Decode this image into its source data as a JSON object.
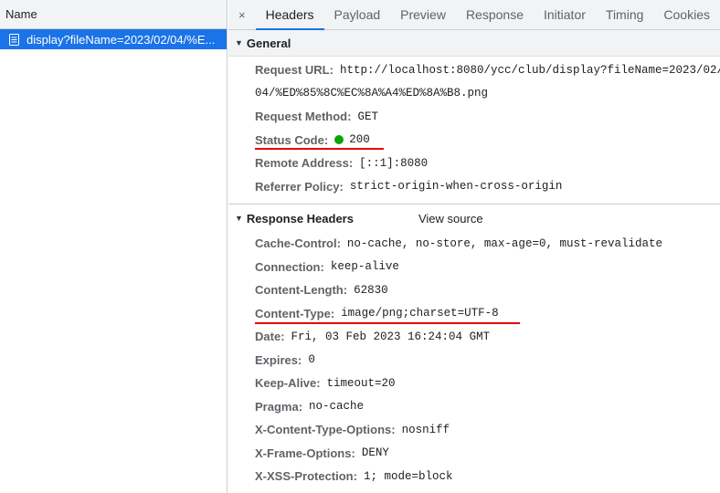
{
  "left": {
    "header": "Name",
    "request": "display?fileName=2023/02/04/%E..."
  },
  "tabs": {
    "close": "×",
    "items": [
      "Headers",
      "Payload",
      "Preview",
      "Response",
      "Initiator",
      "Timing",
      "Cookies"
    ]
  },
  "general": {
    "title": "General",
    "request_url_key": "Request URL",
    "request_url_line1": "http://localhost:8080/ycc/club/display?fileName=2023/02/",
    "request_url_line2": "04/%ED%85%8C%EC%8A%A4%ED%8A%B8.png",
    "request_method_key": "Request Method",
    "request_method_val": "GET",
    "status_code_key": "Status Code",
    "status_code_val": "200",
    "status_color": "#0ca40c",
    "remote_address_key": "Remote Address",
    "remote_address_val": "[::1]:8080",
    "referrer_policy_key": "Referrer Policy",
    "referrer_policy_val": "strict-origin-when-cross-origin"
  },
  "response": {
    "title": "Response Headers",
    "view_source": "View source",
    "headers": [
      {
        "key": "Cache-Control",
        "val": "no-cache, no-store, max-age=0, must-revalidate"
      },
      {
        "key": "Connection",
        "val": "keep-alive"
      },
      {
        "key": "Content-Length",
        "val": "62830"
      },
      {
        "key": "Content-Type",
        "val": "image/png;charset=UTF-8"
      },
      {
        "key": "Date",
        "val": "Fri, 03 Feb 2023 16:24:04 GMT"
      },
      {
        "key": "Expires",
        "val": "0"
      },
      {
        "key": "Keep-Alive",
        "val": "timeout=20"
      },
      {
        "key": "Pragma",
        "val": "no-cache"
      },
      {
        "key": "X-Content-Type-Options",
        "val": "nosniff"
      },
      {
        "key": "X-Frame-Options",
        "val": "DENY"
      },
      {
        "key": "X-XSS-Protection",
        "val": "1; mode=block"
      }
    ]
  },
  "colors": {
    "accent": "#1a73e8",
    "highlight": "#e50000"
  }
}
